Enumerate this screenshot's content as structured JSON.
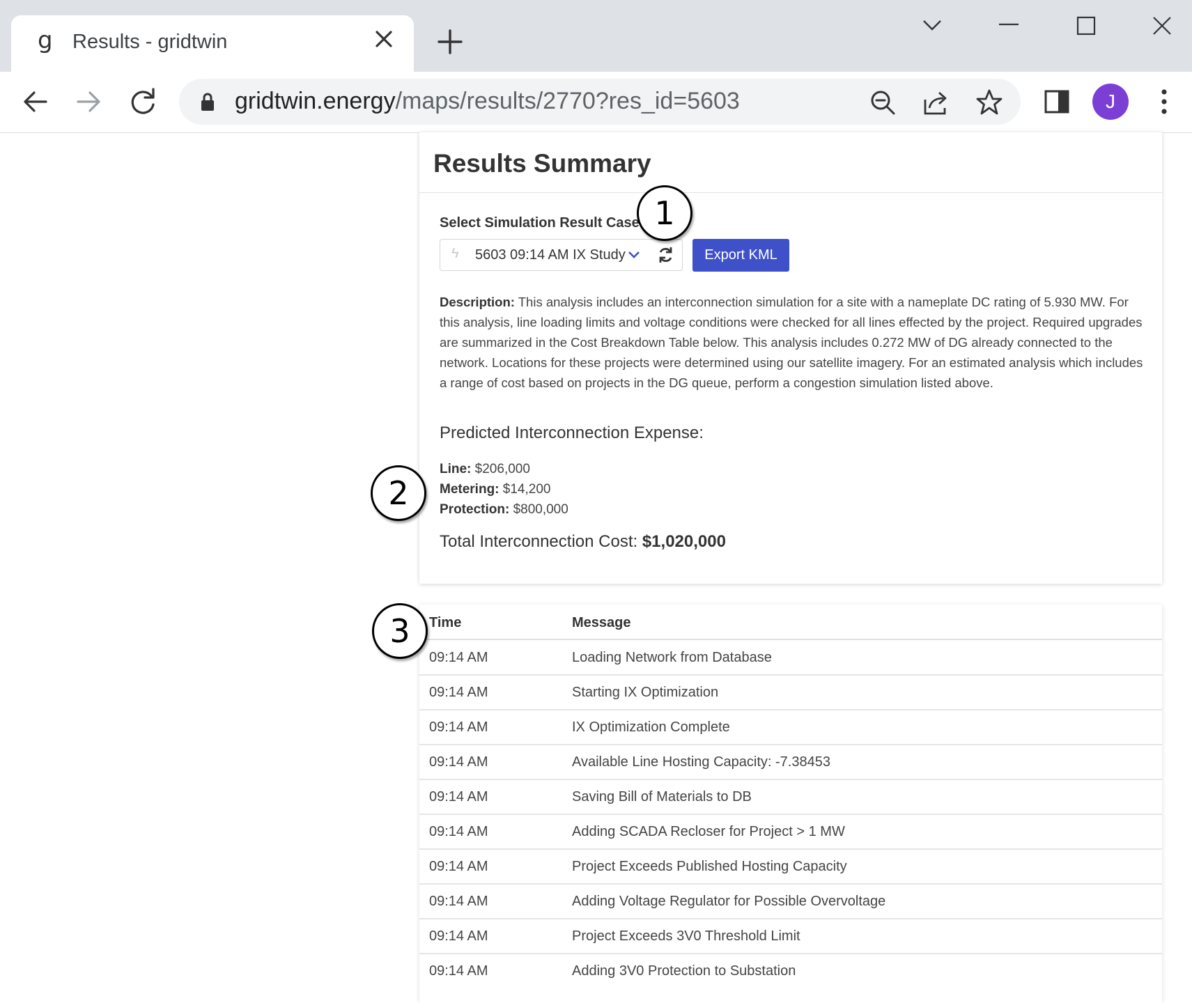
{
  "browser": {
    "tab_favicon": "g",
    "tab_title": "Results - gridtwin",
    "url_host": "gridtwin.energy",
    "url_path": "/maps/results/2770?res_id=5603",
    "profile_initial": "J"
  },
  "summary": {
    "title": "Results Summary",
    "select_label": "Select Simulation Result Case",
    "selected_case": "5603 09:14 AM IX Study",
    "export_label": "Export KML",
    "description_label": "Description:",
    "description_text": "This analysis includes an interconnection simulation for a site with a nameplate DC rating of 5.930 MW. For this analysis, line loading limits and voltage conditions were checked for all lines effected by the project. Required upgrades are summarized in the Cost Breakdown Table below. This analysis includes 0.272 MW of DG already connected to the network. Locations for these projects were determined using our satellite imagery. For an estimated analysis which includes a range of cost based on projects in the DG queue, perform a congestion simulation listed above.",
    "expense_heading": "Predicted Interconnection Expense:",
    "costs": [
      {
        "label": "Line:",
        "value": "$206,000"
      },
      {
        "label": "Metering:",
        "value": "$14,200"
      },
      {
        "label": "Protection:",
        "value": "$800,000"
      }
    ],
    "total_label": "Total Interconnection Cost:",
    "total_value": "$1,020,000"
  },
  "log": {
    "headers": [
      "Time",
      "Message"
    ],
    "rows": [
      {
        "time": "09:14 AM",
        "message": "Loading Network from Database"
      },
      {
        "time": "09:14 AM",
        "message": "Starting IX Optimization"
      },
      {
        "time": "09:14 AM",
        "message": "IX Optimization Complete"
      },
      {
        "time": "09:14 AM",
        "message": "Available Line Hosting Capacity: -7.38453"
      },
      {
        "time": "09:14 AM",
        "message": "Saving Bill of Materials to DB"
      },
      {
        "time": "09:14 AM",
        "message": "Adding SCADA Recloser for Project > 1 MW"
      },
      {
        "time": "09:14 AM",
        "message": "Project Exceeds Published Hosting Capacity"
      },
      {
        "time": "09:14 AM",
        "message": "Adding Voltage Regulator for Possible Overvoltage"
      },
      {
        "time": "09:14 AM",
        "message": "Project Exceeds 3V0 Threshold Limit"
      },
      {
        "time": "09:14 AM",
        "message": "Adding 3V0 Protection to Substation"
      }
    ]
  },
  "callouts": [
    "1",
    "2",
    "3"
  ],
  "colors": {
    "accent_button": "#3f51c8",
    "profile_avatar": "#7b3fd6",
    "chrome_tabstrip": "#dee1e6"
  },
  "icons": [
    "close-icon",
    "plus-icon",
    "chevron-down-icon",
    "minimize-icon",
    "maximize-icon",
    "back-arrow-icon",
    "forward-arrow-icon",
    "reload-icon",
    "lock-icon",
    "zoom-out-icon",
    "share-icon",
    "star-icon",
    "side-panel-icon",
    "kebab-menu-icon",
    "bolt-icon",
    "refresh-icon"
  ]
}
